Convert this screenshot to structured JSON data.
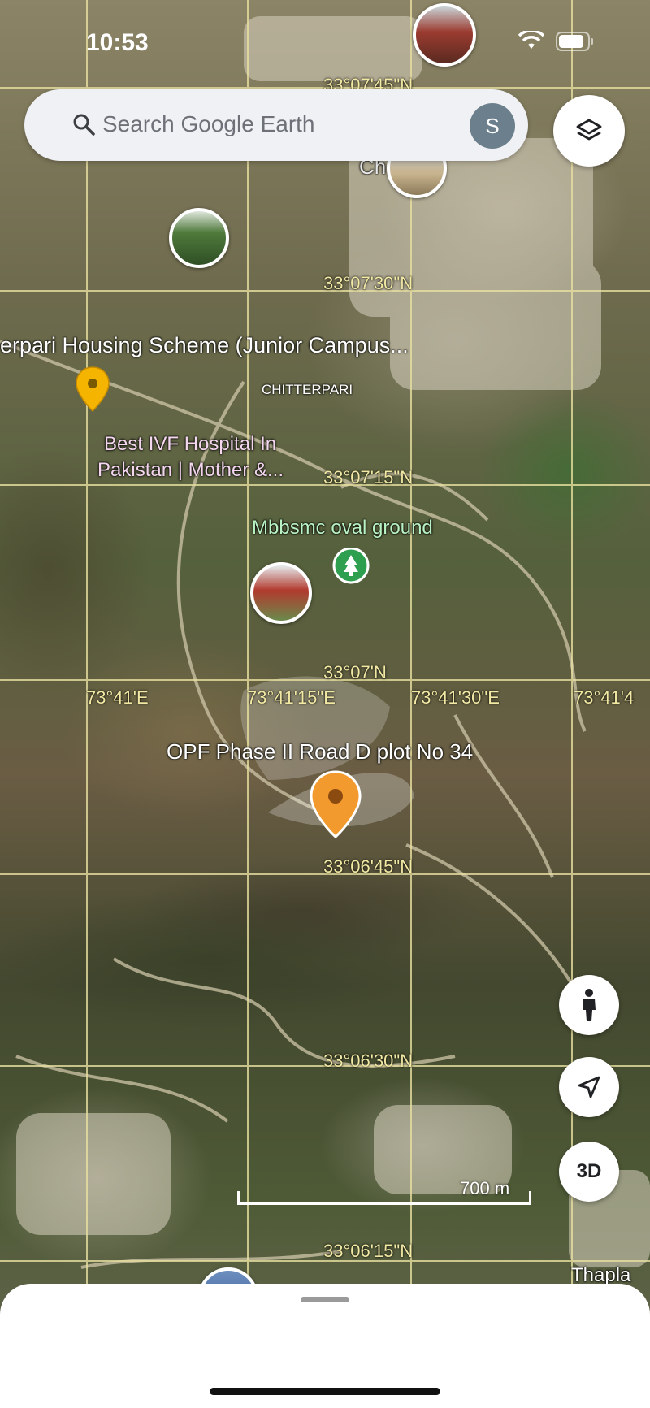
{
  "status_bar": {
    "time": "10:53"
  },
  "search": {
    "placeholder": "Search Google Earth",
    "avatar_letter": "S"
  },
  "map": {
    "latitude_labels": [
      "33°07'45\"N",
      "33°07'30\"N",
      "33°07'15\"N",
      "33°07'N",
      "33°06'45\"N",
      "33°06'30\"N",
      "33°06'15\"N"
    ],
    "longitude_labels": [
      "73°41'E",
      "73°41'15\"E",
      "73°41'30\"E",
      "73°41'4"
    ],
    "places": {
      "housing_scheme": "erpari Housing Scheme (Junior Campus...",
      "chitterpari": "CHITTERPARI",
      "ivf_hospital_line1": "Best IVF Hospital In",
      "ivf_hospital_line2": "Pakistan | Mother &...",
      "oval_ground": "Mbbsmc oval ground",
      "plot": "OPF Phase II Road D plot No 34",
      "thapla": "Thapla",
      "partial_top": "Ch          an"
    },
    "scale_label": "700 m"
  },
  "controls": {
    "three_d": "3D"
  },
  "colors": {
    "grid": "#e8e0a0",
    "coord_text": "#f2e9a4",
    "pin_orange": "#f29a2e",
    "pin_yellow": "#f5b400",
    "pin_green": "#2e9f4f"
  },
  "icons": [
    "search-icon",
    "layers-icon",
    "pegman-icon",
    "location-arrow-icon",
    "signal-icon",
    "wifi-icon",
    "battery-icon",
    "tree-icon"
  ]
}
